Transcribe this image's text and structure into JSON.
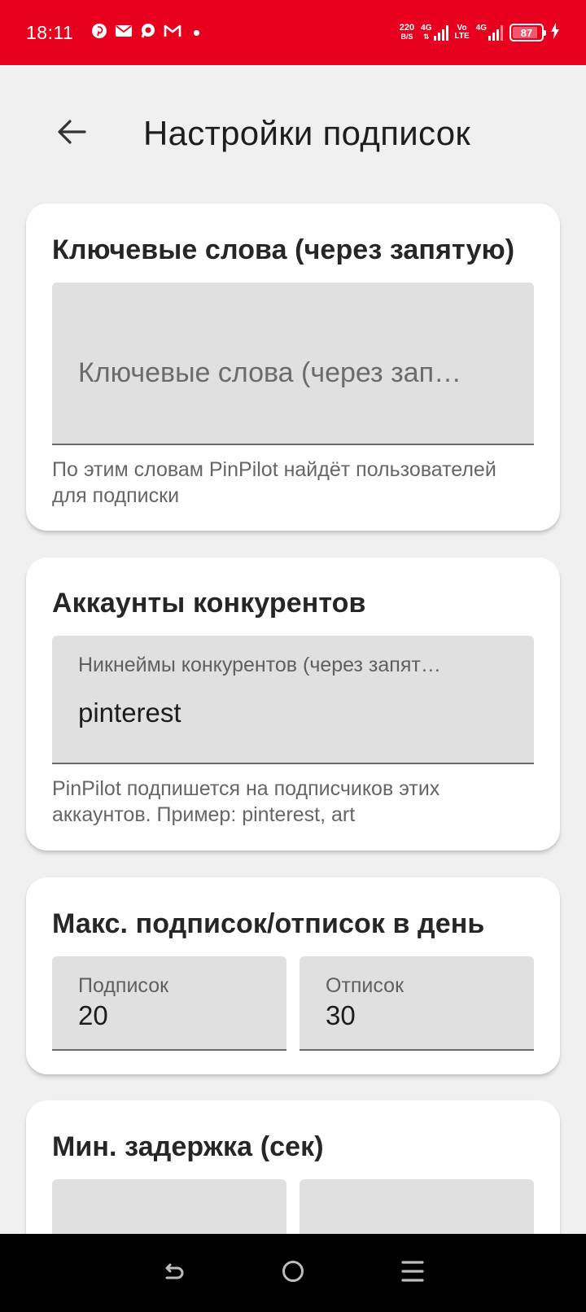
{
  "status_bar": {
    "time": "18:11",
    "net_speed_value": "220",
    "net_speed_unit": "B/S",
    "sim1_type": "4G",
    "volte_top": "Vo",
    "volte_bottom": "LTE",
    "sim2_type": "4G",
    "battery_level": "87",
    "notification_icons": [
      "pinterest-icon",
      "mail-icon",
      "chat-icon",
      "gmail-icon"
    ]
  },
  "header": {
    "title": "Настройки подписок"
  },
  "keywords_card": {
    "title": "Ключевые слова (через запятую)",
    "input_placeholder": "Ключевые слова (через зап…",
    "input_value": "",
    "helper": "По этим словам PinPilot найдёт пользователей для подписки"
  },
  "competitors_card": {
    "title": "Аккаунты конкурентов",
    "input_label": "Никнеймы конкурентов (через запят…",
    "input_value": "pinterest",
    "helper": "PinPilot подпишется на подписчиков этих аккаунтов. Пример: pinterest, art"
  },
  "max_card": {
    "title": "Макс. подписок/отписок в день",
    "follow_label": "Подписок",
    "follow_value": "20",
    "unfollow_label": "Отписок",
    "unfollow_value": "30"
  },
  "delay_card": {
    "title": "Мин. задержка (сек)"
  },
  "colors": {
    "status_bar": "#e8001f",
    "background": "#f0f0f0",
    "field_fill": "#e0e0e0"
  }
}
